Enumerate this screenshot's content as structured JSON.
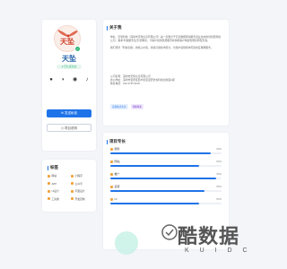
{
  "profile": {
    "logo_text": "天坠",
    "name": "天坠",
    "cert_label": "● 已认证企业",
    "social": [
      "qq-icon",
      "wechat-icon",
      "weibo-icon",
      "douyin-icon"
    ],
    "primary_button": "✉ 发送私信",
    "secondary_button": "⎙ 项目说明"
  },
  "tags": {
    "title": "标签",
    "items": [
      "网站",
      "小程序",
      "APP",
      "公众号",
      "UI设计",
      "平面设计",
      "工具类",
      "开发定制"
    ]
  },
  "about": {
    "title": "关于我",
    "paragraphs": [
      "你好，天坠科技（深圳市天坠信息有限公司）是一家致力于打造数据驱动服务商业生态的创新型科技公司，秉承“科技服务生活”的理念，为客户提供优质服务并协助客户构建智能化转型方案。",
      "我们坚持「科技创新」的核心价值，持续打磨技术能力，为用户提供简单可靠的互联网服务。"
    ],
    "contact": [
      "公司名称：深圳市天坠信息有限公司",
      "办公地址：深圳市宝安区西乡街道宝安智谷科技创新园A座",
      "联系电话：199-2745-6232"
    ],
    "badges": [
      "高新技术企业",
      "专精特新"
    ]
  },
  "skills": {
    "title": "项目专长",
    "items": [
      {
        "name": "服务",
        "value": 90,
        "label": "90%"
      },
      {
        "name": "网站",
        "value": 80,
        "label": "80%"
      },
      {
        "name": "推广",
        "value": 95,
        "label": "95%"
      },
      {
        "name": "运营",
        "value": 85,
        "label": "85%"
      },
      {
        "name": "UI",
        "value": 80,
        "label": "80%"
      }
    ]
  },
  "watermark": {
    "title": "酷数据",
    "subtitle": "K U I D C"
  },
  "colors": {
    "accent": "#1f73e8",
    "brand_red": "#d0402c",
    "verified_green": "#2bb673",
    "tag_dot": "#f2a23c"
  }
}
